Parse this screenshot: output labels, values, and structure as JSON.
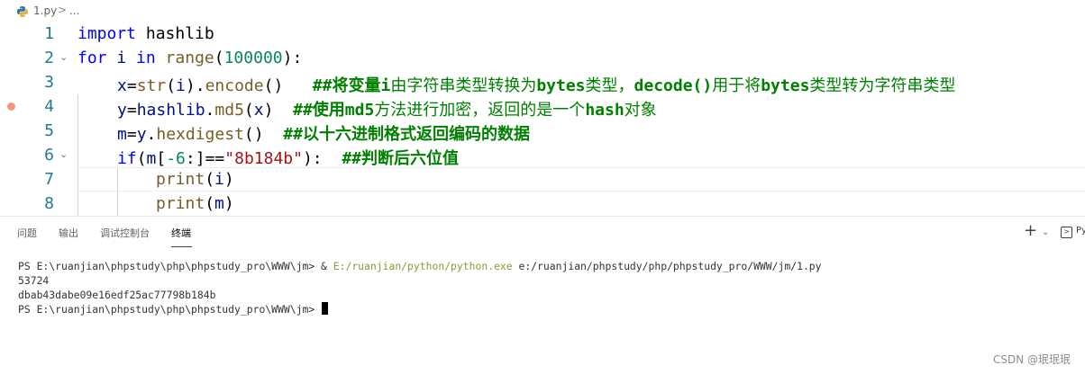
{
  "breadcrumb": {
    "file": "1.py",
    "separator": ">",
    "ellipsis": "..."
  },
  "editor": {
    "lines": [
      {
        "n": "1"
      },
      {
        "n": "2"
      },
      {
        "n": "3"
      },
      {
        "n": "4"
      },
      {
        "n": "5"
      },
      {
        "n": "6"
      },
      {
        "n": "7"
      },
      {
        "n": "8"
      }
    ],
    "code": {
      "l1_kw": "import",
      "l1_rest": " hashlib",
      "l2_for": "for",
      "l2_i": " i ",
      "l2_in": "in",
      "l2_range": " range",
      "l2_open": "(",
      "l2_num": "100000",
      "l2_close": "):",
      "l3_x": "x",
      "l3_eq": "=",
      "l3_str": "str",
      "l3_p1": "(",
      "l3_i": "i",
      "l3_p2": ").",
      "l3_encode": "encode",
      "l3_p3": "()",
      "l3_comment_a": "   ##将变量",
      "l3_comment_b": "i",
      "l3_comment_c": "由字符串类型转换为",
      "l3_comment_d": "bytes",
      "l3_comment_e": "类型，",
      "l3_comment_f": "decode()",
      "l3_comment_g": "用于将",
      "l3_comment_h": "bytes",
      "l3_comment_i": "类型转为字符串类型",
      "l4_y": "y",
      "l4_eq": "=",
      "l4_hashlib": "hashlib",
      "l4_dot": ".",
      "l4_md5": "md5",
      "l4_p1": "(",
      "l4_x": "x",
      "l4_p2": ")",
      "l4_comment_a": "  ##使用",
      "l4_comment_b": "md5",
      "l4_comment_c": "方法进行加密，返回的是一个",
      "l4_comment_d": "hash",
      "l4_comment_e": "对象",
      "l5_m": "m",
      "l5_eq": "=",
      "l5_y": "y",
      "l5_dot": ".",
      "l5_hex": "hexdigest",
      "l5_p": "()",
      "l5_comment": "  ##以十六进制格式返回编码的数据",
      "l6_if": "if",
      "l6_p1": "(",
      "l6_m": "m",
      "l6_b1": "[",
      "l6_n6": "-6",
      "l6_b2": ":]==",
      "l6_str": "\"8b184b\"",
      "l6_p2": "):",
      "l6_comment": "  ##判断后六位值",
      "l7_print": "print",
      "l7_p1": "(",
      "l7_i": "i",
      "l7_p2": ")",
      "l8_print": "print",
      "l8_p1": "(",
      "l8_m": "m",
      "l8_p2": ")"
    }
  },
  "panel": {
    "tabs": [
      "问题",
      "输出",
      "调试控制台",
      "终端"
    ],
    "active_tab": "终端",
    "actions": {
      "plus": "+",
      "chevron": "⌄",
      "terminal_label": "Py"
    }
  },
  "terminal": {
    "prompt1": "PS E:\\ruanjian\\phpstudy\\php\\phpstudy_pro\\WWW\\jm> & ",
    "exe": "E:/ruanjian/python/python.exe",
    "script": " e:/ruanjian/phpstudy/php/phpstudy_pro/WWW/jm/1.py",
    "out1": "53724",
    "out2": "dbab43dabe09e16edf25ac77798b184b",
    "prompt2": "PS E:\\ruanjian\\phpstudy\\php\\phpstudy_pro\\WWW\\jm> "
  },
  "watermark": "CSDN @珉珉珉",
  "colors": {
    "keyword": "#0000ff",
    "function": "#795e26",
    "comment": "#008000",
    "string": "#a31515",
    "number": "#098658",
    "line_number": "#237893"
  }
}
